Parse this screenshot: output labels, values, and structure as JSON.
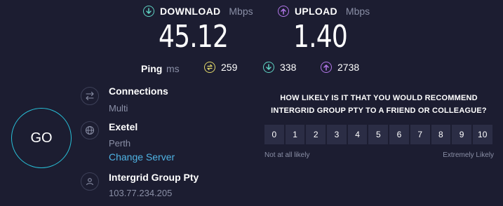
{
  "download": {
    "label": "DOWNLOAD",
    "unit": "Mbps",
    "value": "45.12",
    "color": "#5fd3c3"
  },
  "upload": {
    "label": "UPLOAD",
    "unit": "Mbps",
    "value": "1.40",
    "color": "#b277e8"
  },
  "ping": {
    "label": "Ping",
    "unit": "ms",
    "idle": {
      "value": "259",
      "icon": "ping-idle-icon",
      "color": "#e2d86a"
    },
    "download": {
      "value": "338",
      "icon": "ping-download-icon",
      "color": "#5fd3c3"
    },
    "upload": {
      "value": "2738",
      "icon": "ping-upload-icon",
      "color": "#b277e8"
    }
  },
  "go_button": {
    "label": "GO",
    "ring_color": "#28c0d8"
  },
  "connections": {
    "title": "Connections",
    "value": "Multi",
    "icon": "connections-icon"
  },
  "isp": {
    "name": "Exetel",
    "location": "Perth",
    "change_link": "Change Server",
    "icon": "globe-icon"
  },
  "host": {
    "name": "Intergrid Group Pty",
    "ip": "103.77.234.205",
    "icon": "user-icon"
  },
  "survey": {
    "question_line1": "HOW LIKELY IS IT THAT YOU WOULD RECOMMEND",
    "question_line2": "INTERGRID GROUP PTY TO A FRIEND OR COLLEAGUE?",
    "scale": [
      "0",
      "1",
      "2",
      "3",
      "4",
      "5",
      "6",
      "7",
      "8",
      "9",
      "10"
    ],
    "low_label": "Not at all likely",
    "high_label": "Extremely Likely"
  },
  "colors": {
    "background": "#1c1d31",
    "cell": "#2b2d45",
    "muted": "#8a8fa6",
    "link": "#4fb3e4"
  }
}
